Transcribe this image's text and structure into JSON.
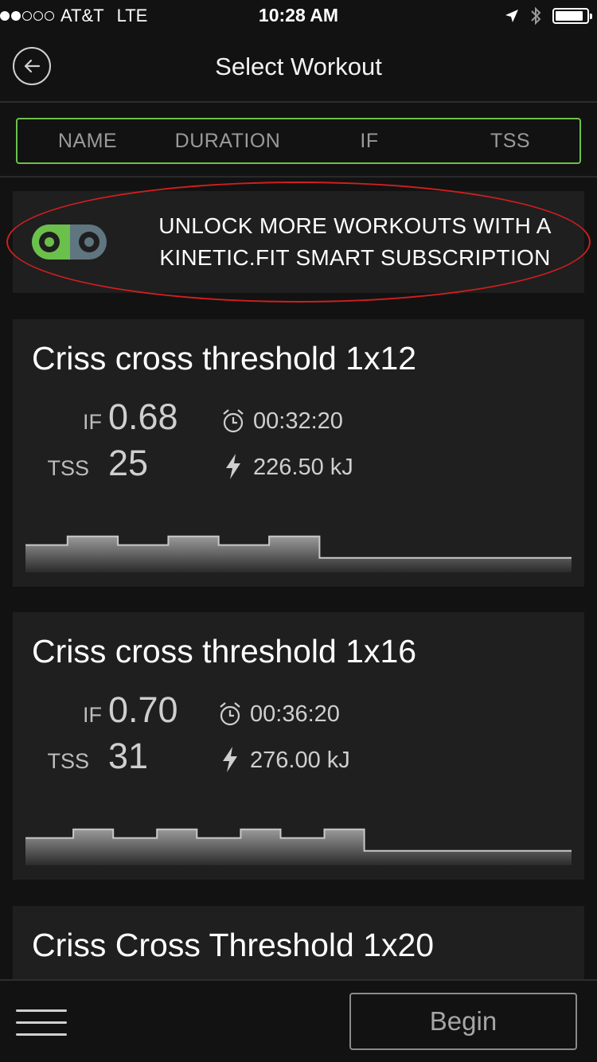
{
  "status_bar": {
    "carrier": "AT&T",
    "network": "LTE",
    "time": "10:28 AM",
    "signal_bars": 2,
    "signal_total": 5,
    "battery_level": 0.9,
    "icons": [
      "location-arrow-icon",
      "bluetooth-icon",
      "battery-icon"
    ]
  },
  "nav": {
    "title": "Select Workout",
    "back_icon": "back-arrow-icon"
  },
  "sort_tabs": [
    {
      "label": "NAME",
      "active": false
    },
    {
      "label": "DURATION",
      "active": true
    },
    {
      "label": "IF",
      "active": false
    },
    {
      "label": "TSS",
      "active": false
    }
  ],
  "promo": {
    "line1": "UNLOCK MORE WORKOUTS WITH A",
    "line2": "KINETIC.FIT SMART SUBSCRIPTION",
    "logo": "kinetic-fit-logo",
    "highlight_color": "#d01f1f"
  },
  "workouts": [
    {
      "title": "Criss cross threshold 1x12",
      "if_label": "IF",
      "if_value": "0.68",
      "tss_label": "TSS",
      "tss_value": "25",
      "duration": "00:32:20",
      "energy": "226.50 kJ",
      "profile": [
        {
          "level": 0.6,
          "dur": 1.0
        },
        {
          "level": 0.8,
          "dur": 1.2
        },
        {
          "level": 0.6,
          "dur": 1.2
        },
        {
          "level": 0.8,
          "dur": 1.2
        },
        {
          "level": 0.6,
          "dur": 1.2
        },
        {
          "level": 0.8,
          "dur": 1.2
        },
        {
          "level": 0.3,
          "dur": 6.0
        }
      ]
    },
    {
      "title": "Criss cross threshold 1x16",
      "if_label": "IF",
      "if_value": "0.70",
      "tss_label": "TSS",
      "tss_value": "31",
      "duration": "00:36:20",
      "energy": "276.00 kJ",
      "profile": [
        {
          "level": 0.6,
          "dur": 1.2
        },
        {
          "level": 0.8,
          "dur": 1.0
        },
        {
          "level": 0.6,
          "dur": 1.1
        },
        {
          "level": 0.8,
          "dur": 1.0
        },
        {
          "level": 0.6,
          "dur": 1.1
        },
        {
          "level": 0.8,
          "dur": 1.0
        },
        {
          "level": 0.6,
          "dur": 1.1
        },
        {
          "level": 0.8,
          "dur": 1.0
        },
        {
          "level": 0.3,
          "dur": 5.2
        }
      ]
    },
    {
      "title": "Criss Cross Threshold 1x20"
    }
  ],
  "bottom_bar": {
    "menu_icon": "hamburger-menu-icon",
    "begin_label": "Begin"
  },
  "colors": {
    "accent": "#6bc04b",
    "background": "#121212",
    "card": "#1f1f1f",
    "logo_gray": "#5f7580"
  }
}
